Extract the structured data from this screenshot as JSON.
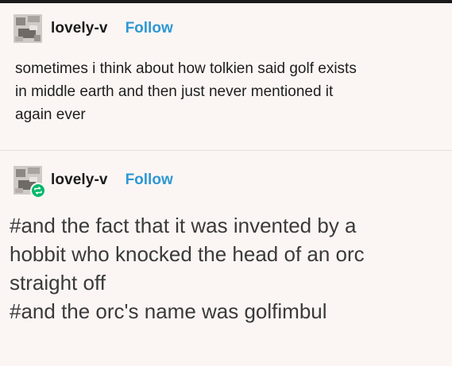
{
  "posts": [
    {
      "username": "lovely-v",
      "follow_label": "Follow",
      "body_lines": [
        "sometimes i think about how tolkien said golf exists",
        "in middle earth and then just never mentioned it",
        "again ever"
      ]
    },
    {
      "username": "lovely-v",
      "follow_label": "Follow",
      "reblog_icon": "reblog-icon",
      "tag_lines": [
        "#and the fact that it was invented by a",
        "hobbit who knocked the head of an orc",
        "straight off",
        "#and the orc's name was golfimbul"
      ]
    }
  ],
  "colors": {
    "background": "#fbf6f4",
    "follow": "#2e98d4",
    "reblog_badge": "#00b86b"
  }
}
